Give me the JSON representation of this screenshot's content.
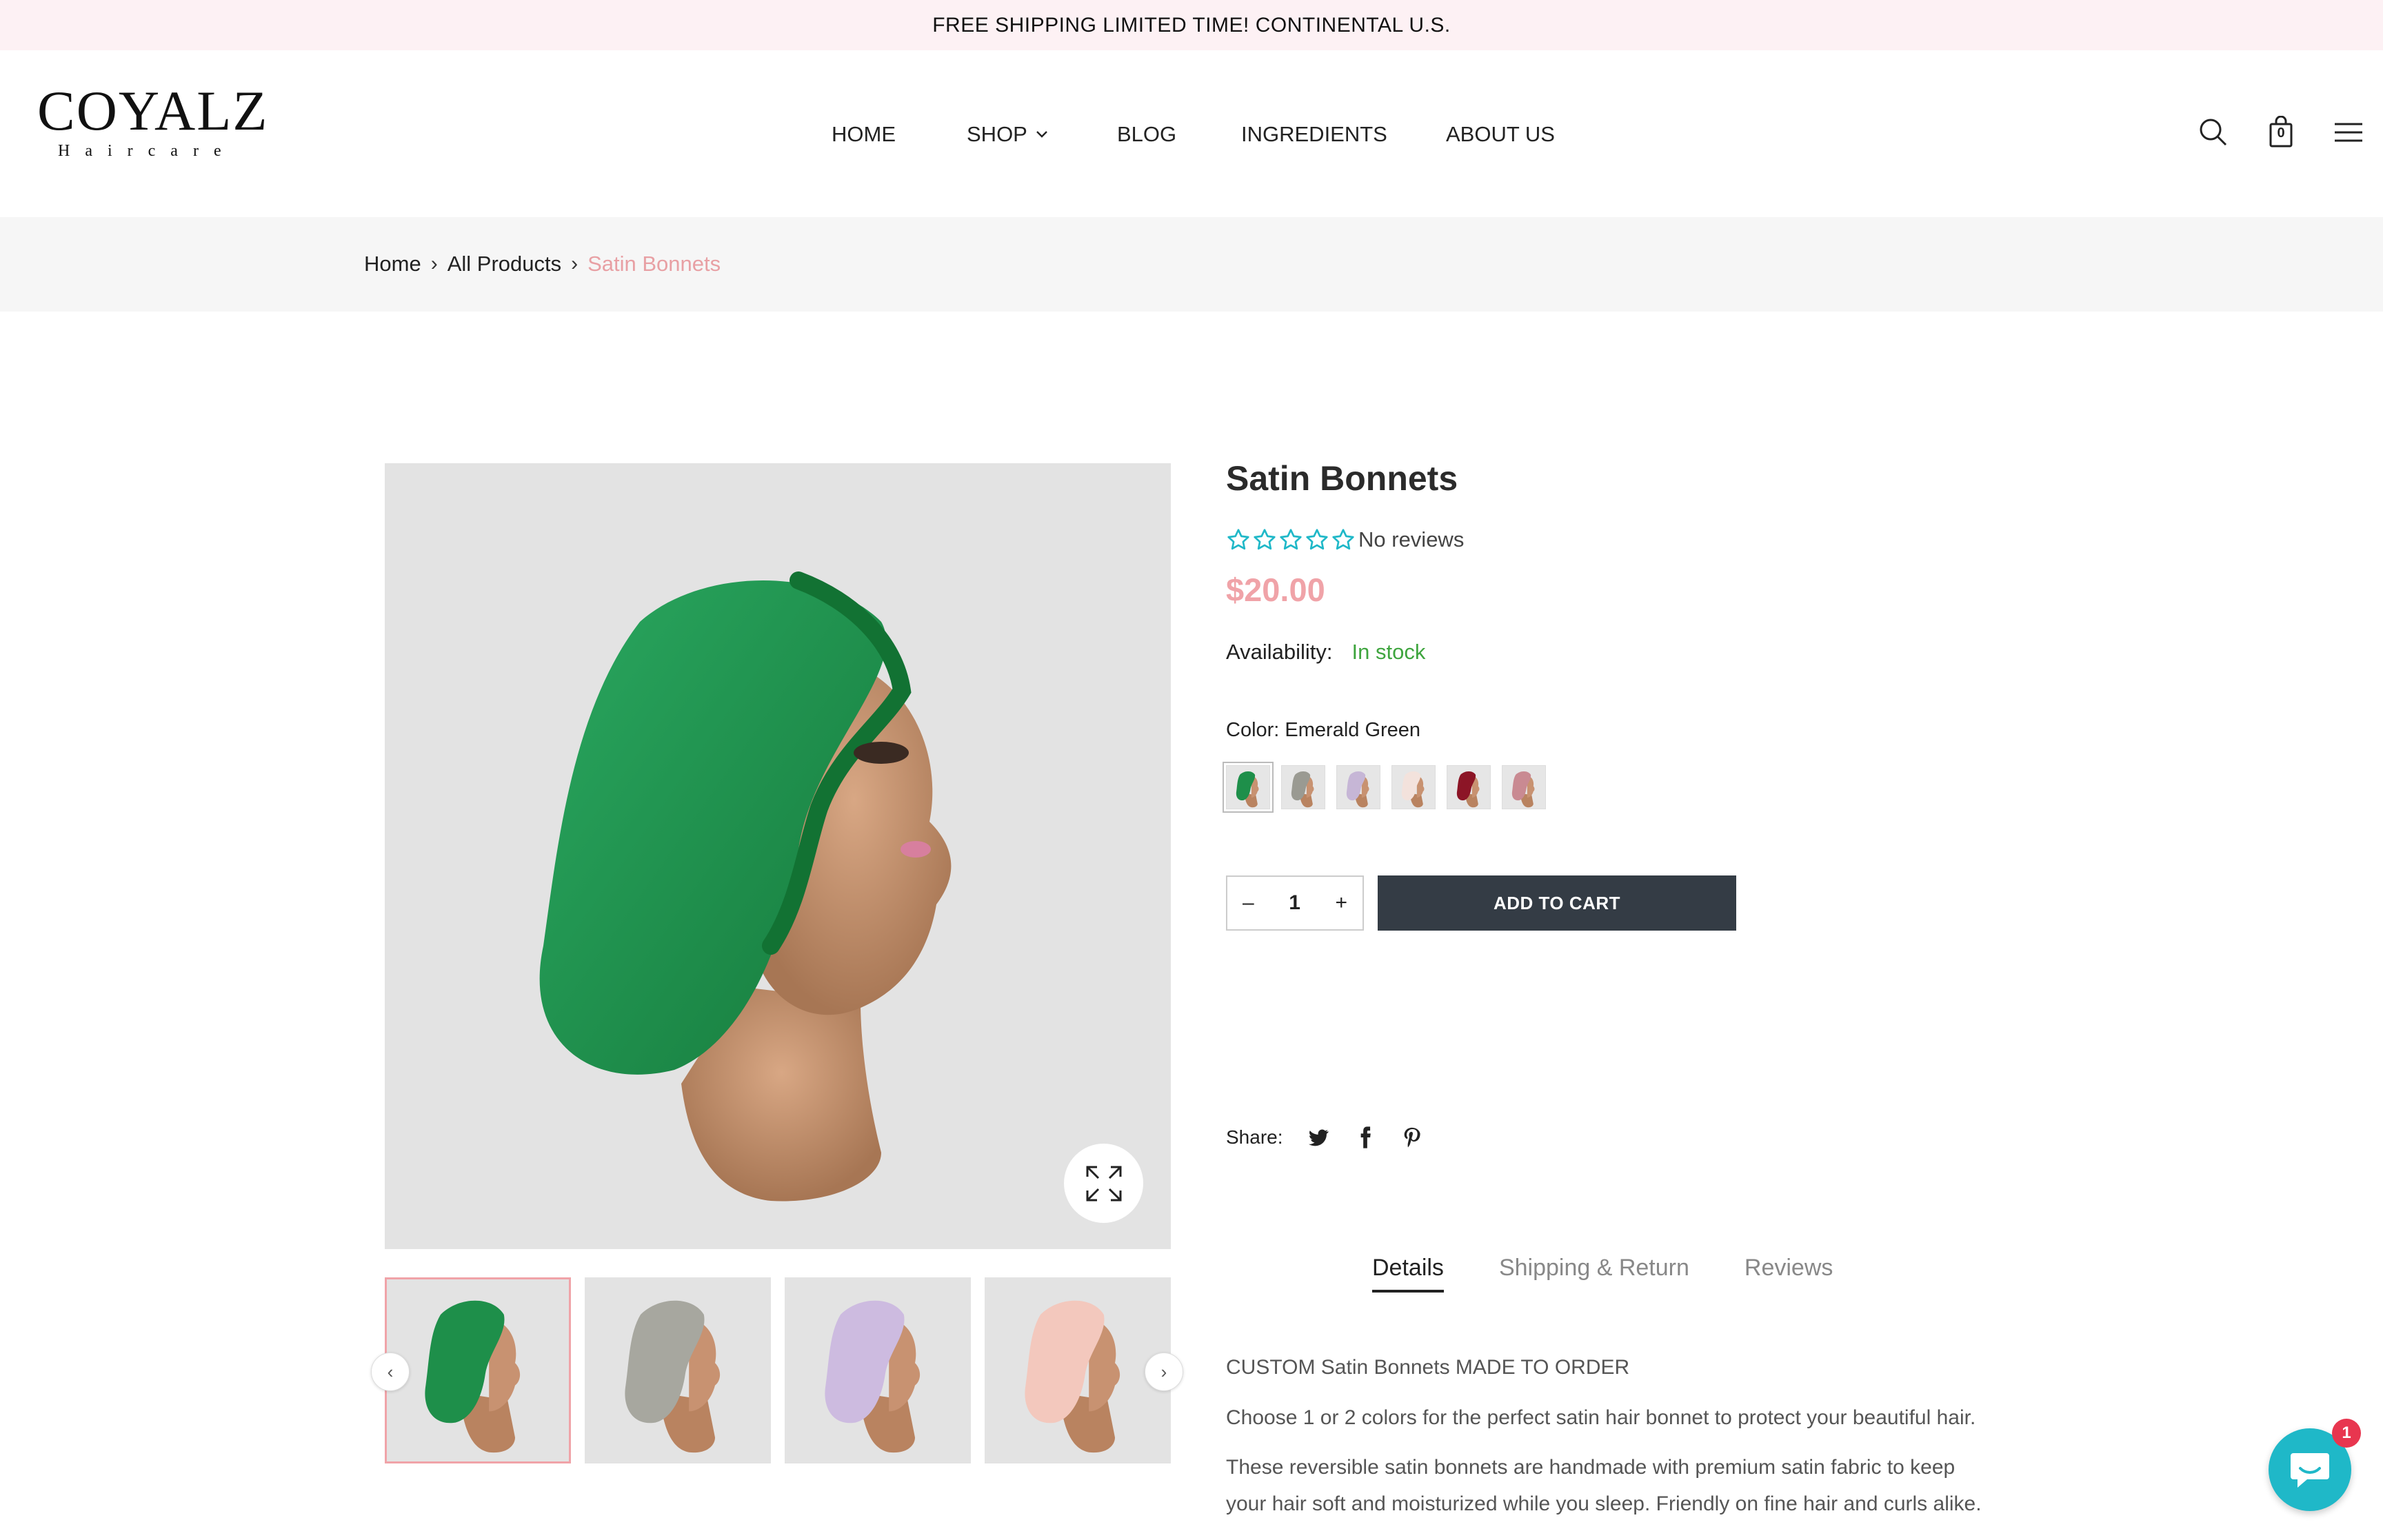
{
  "announcement": "FREE SHIPPING LIMITED TIME! CONTINENTAL U.S.",
  "logo": {
    "main": "COYALZ",
    "sub": "Haircare"
  },
  "nav": {
    "home": "HOME",
    "shop": "SHOP",
    "blog": "BLOG",
    "ingredients": "INGREDIENTS",
    "about": "ABOUT US"
  },
  "header_icons": [
    "search-icon",
    "cart-icon",
    "menu-icon"
  ],
  "cart_count": "0",
  "breadcrumb": {
    "home": "Home",
    "all": "All Products",
    "current": "Satin Bonnets"
  },
  "product": {
    "title": "Satin Bonnets",
    "reviews": "No reviews",
    "rating_stars": 5,
    "rating_value": 0,
    "price": "$20.00",
    "availability_label": "Availability:",
    "availability_value": "In stock",
    "color_label": "Color: Emerald Green",
    "swatch_colors": [
      "#1e8f4a",
      "#9a9a92",
      "#c6b6d6",
      "#f3e2dc",
      "#8c1526",
      "#c98a92"
    ],
    "quantity": "1",
    "qty_minus": "–",
    "qty_plus": "+",
    "add_to_cart": "ADD TO CART",
    "share_label": "Share:"
  },
  "thumbnails": [
    {
      "color": "#1e8f4a"
    },
    {
      "color": "#a7a79f"
    },
    {
      "color": "#cdbbe0"
    },
    {
      "color": "#f3c8bd"
    }
  ],
  "tabs": [
    "Details",
    "Shipping & Return",
    "Reviews"
  ],
  "description": [
    "CUSTOM Satin Bonnets MADE TO ORDER",
    "Choose 1 or 2 colors for the perfect satin hair bonnet to protect your beautiful hair.",
    "These reversible satin bonnets are handmade with premium satin fabric to keep your hair soft and moisturized while you sleep. Friendly on fine hair and curls alike."
  ],
  "chat_badge": "1",
  "colors": {
    "accent": "#f0a3a8",
    "stock": "#3fa53f",
    "button": "#343c45",
    "star": "#1fb8c8",
    "chat": "#1fb8c8"
  }
}
